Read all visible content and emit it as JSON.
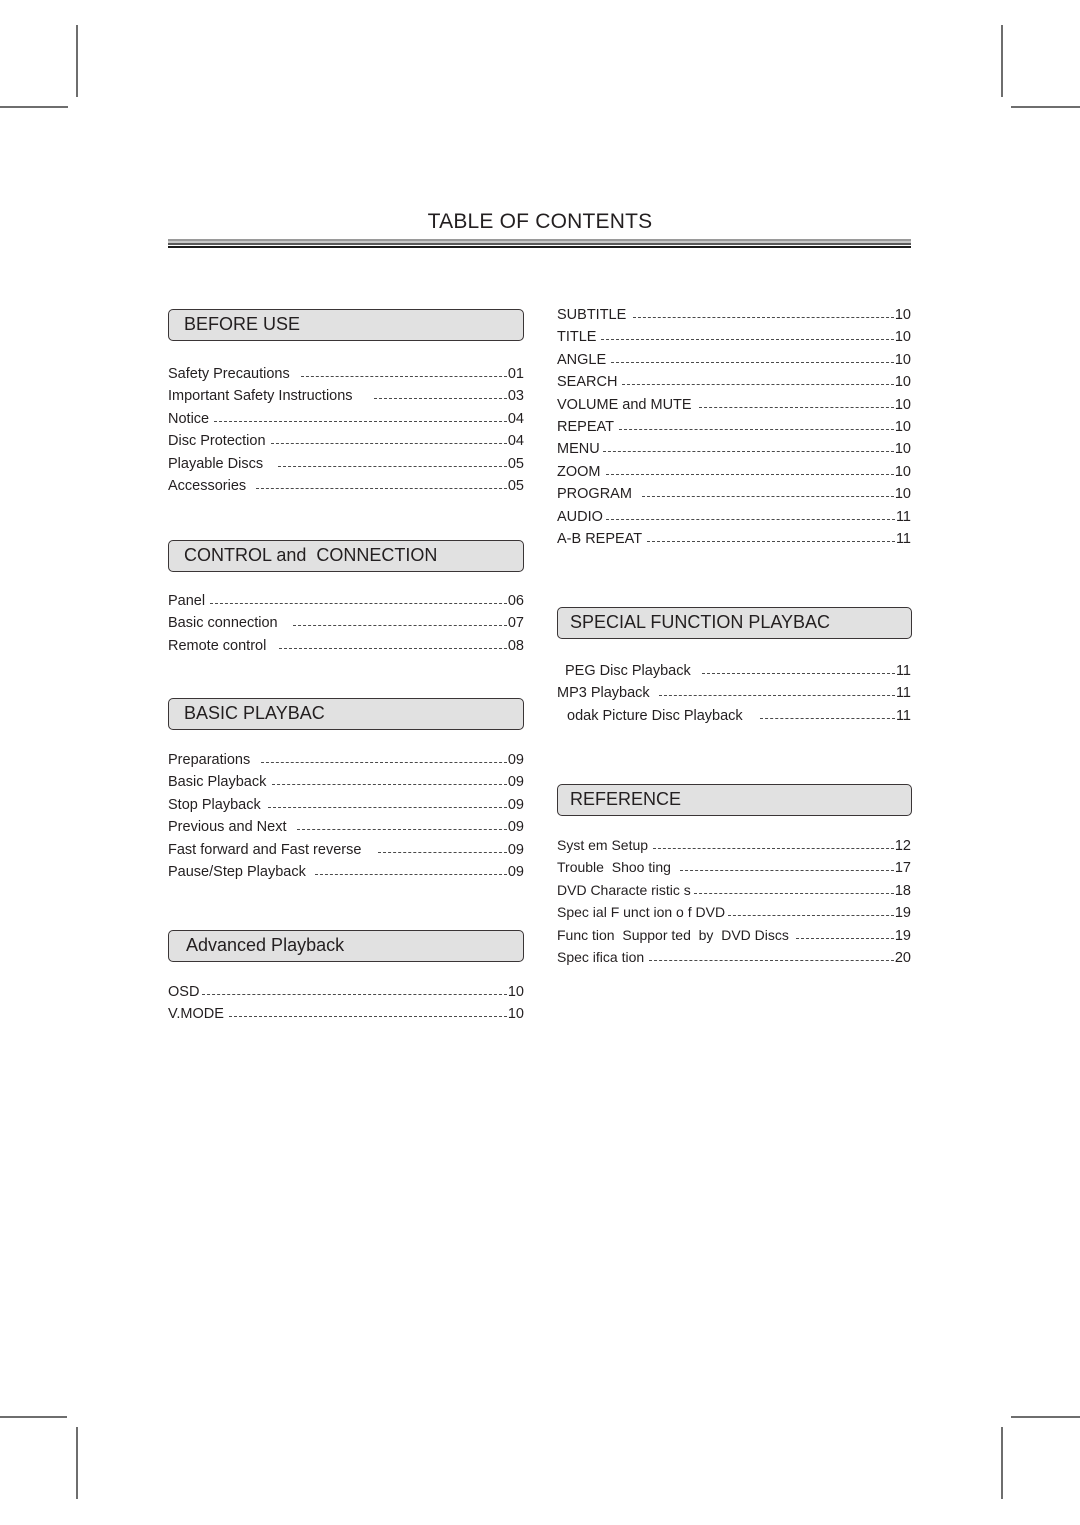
{
  "document": {
    "title": "TABLE OF CONTENTS"
  },
  "left_column": {
    "sections": [
      {
        "heading": "BEFORE USE",
        "entries": [
          {
            "label": "Safety Precautions",
            "page": "01"
          },
          {
            "label": "Important Safety Instructions",
            "page": "03"
          },
          {
            "label": "Notice",
            "page": "04"
          },
          {
            "label": "Disc Protection",
            "page": "04"
          },
          {
            "label": "Playable Discs",
            "page": "05"
          },
          {
            "label": "Accessories",
            "page": "05"
          }
        ]
      },
      {
        "heading": "CONTROL and  CONNECTION",
        "entries": [
          {
            "label": "Panel",
            "page": "06"
          },
          {
            "label": "Basic connection",
            "page": "07"
          },
          {
            "label": "Remote control",
            "page": "08"
          }
        ]
      },
      {
        "heading": "BASIC PLAYBAC",
        "entries": [
          {
            "label": "Preparations",
            "page": "09"
          },
          {
            "label": "Basic Playback",
            "page": "09"
          },
          {
            "label": "Stop Playback",
            "page": "09"
          },
          {
            "label": "Previous and Next",
            "page": "09"
          },
          {
            "label": "Fast forward and Fast reverse",
            "page": "09"
          },
          {
            "label": "Pause/Step Playback",
            "page": "09"
          }
        ]
      },
      {
        "heading": "Advanced Playback",
        "entries": [
          {
            "label": "OSD",
            "page": "10"
          },
          {
            "label": "V.MODE",
            "page": "10"
          }
        ]
      }
    ]
  },
  "right_column": {
    "continued_entries": [
      {
        "label": "SUBTITLE",
        "page": "10"
      },
      {
        "label": "TITLE",
        "page": "10"
      },
      {
        "label": "ANGLE",
        "page": "10"
      },
      {
        "label": "SEARCH",
        "page": "10"
      },
      {
        "label": "VOLUME and MUTE",
        "page": "10"
      },
      {
        "label": "REPEAT",
        "page": "10"
      },
      {
        "label": "MENU",
        "page": "10"
      },
      {
        "label": "ZOOM",
        "page": "10"
      },
      {
        "label": "PROGRAM",
        "page": "10"
      },
      {
        "label": "AUDIO",
        "page": "11"
      },
      {
        "label": "A-B REPEAT",
        "page": "11"
      }
    ],
    "sections": [
      {
        "heading": "SPECIAL FUNCTION PLAYBAC",
        "entries": [
          {
            "label": "PEG Disc Playback",
            "page": "11"
          },
          {
            "label": "MP3 Playback",
            "page": "11"
          },
          {
            "label": "odak Picture Disc Playback",
            "page": "11"
          }
        ]
      },
      {
        "heading": "REFERENCE",
        "entries": [
          {
            "label": "Syst em Setup",
            "page": "12"
          },
          {
            "label": "Trouble  Shoo ting",
            "page": "17"
          },
          {
            "label": "DVD Characte ristic s",
            "page": "18"
          },
          {
            "label": "Spec ial F unct ion o f DVD",
            "page": "19"
          },
          {
            "label": "Func tion  Suppor ted  by  DVD Discs",
            "page": "19"
          },
          {
            "label": "Spec ifica tion",
            "page": "20"
          }
        ]
      }
    ]
  }
}
